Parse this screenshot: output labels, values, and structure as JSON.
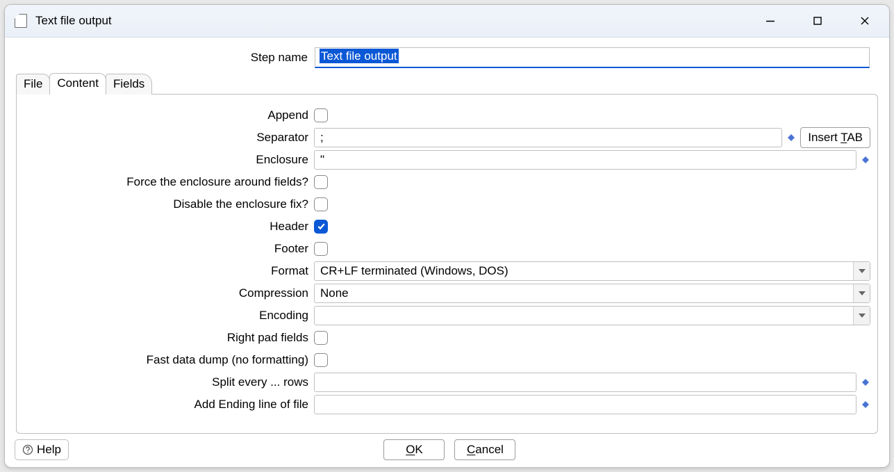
{
  "window": {
    "title": "Text file output"
  },
  "step_name": {
    "label": "Step name",
    "value": "Text file output"
  },
  "tabs": {
    "file": "File",
    "content": "Content",
    "fields": "Fields",
    "active": "Content"
  },
  "content": {
    "append_label": "Append",
    "append_checked": false,
    "separator_label": "Separator",
    "separator_value": ";",
    "insert_tab_label_prefix": "Insert ",
    "insert_tab_accesskey": "T",
    "insert_tab_label_suffix": "AB",
    "enclosure_label": "Enclosure",
    "enclosure_value": "\"",
    "force_enclosure_label": "Force the enclosure around fields?",
    "force_enclosure_checked": false,
    "disable_enclosure_fix_label": "Disable the enclosure fix?",
    "disable_enclosure_fix_checked": false,
    "header_label": "Header",
    "header_checked": true,
    "footer_label": "Footer",
    "footer_checked": false,
    "format_label": "Format",
    "format_value": "CR+LF terminated (Windows, DOS)",
    "compression_label": "Compression",
    "compression_value": "None",
    "encoding_label": "Encoding",
    "encoding_value": "",
    "right_pad_label": "Right pad fields",
    "right_pad_checked": false,
    "fast_dump_label": "Fast data dump (no formatting)",
    "fast_dump_checked": false,
    "split_rows_label": "Split every ... rows",
    "split_rows_value": "",
    "ending_line_label": "Add Ending line of file",
    "ending_line_value": ""
  },
  "buttons": {
    "help": "Help",
    "ok_access": "O",
    "ok_suffix": "K",
    "cancel_access": "C",
    "cancel_suffix": "ancel"
  }
}
